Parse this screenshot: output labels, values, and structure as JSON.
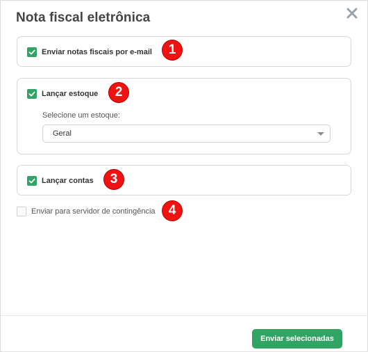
{
  "modal": {
    "title": "Nota fiscal eletrônica",
    "close_icon": "close-icon"
  },
  "options": {
    "email": {
      "label": "Enviar notas fiscais por e-mail",
      "checked": true,
      "badge": "1"
    },
    "estoque": {
      "label": "Lançar estoque",
      "checked": true,
      "badge": "2",
      "select_label": "Selecione um estoque:",
      "select_value": "Geral"
    },
    "contas": {
      "label": "Lançar contas",
      "checked": true,
      "badge": "3"
    },
    "contingencia": {
      "label": "Enviar para servidor de contingência",
      "checked": false,
      "badge": "4"
    }
  },
  "footer": {
    "submit_label": "Enviar selecionadas"
  },
  "colors": {
    "accent": "#31a463",
    "badge": "#ee1212"
  }
}
